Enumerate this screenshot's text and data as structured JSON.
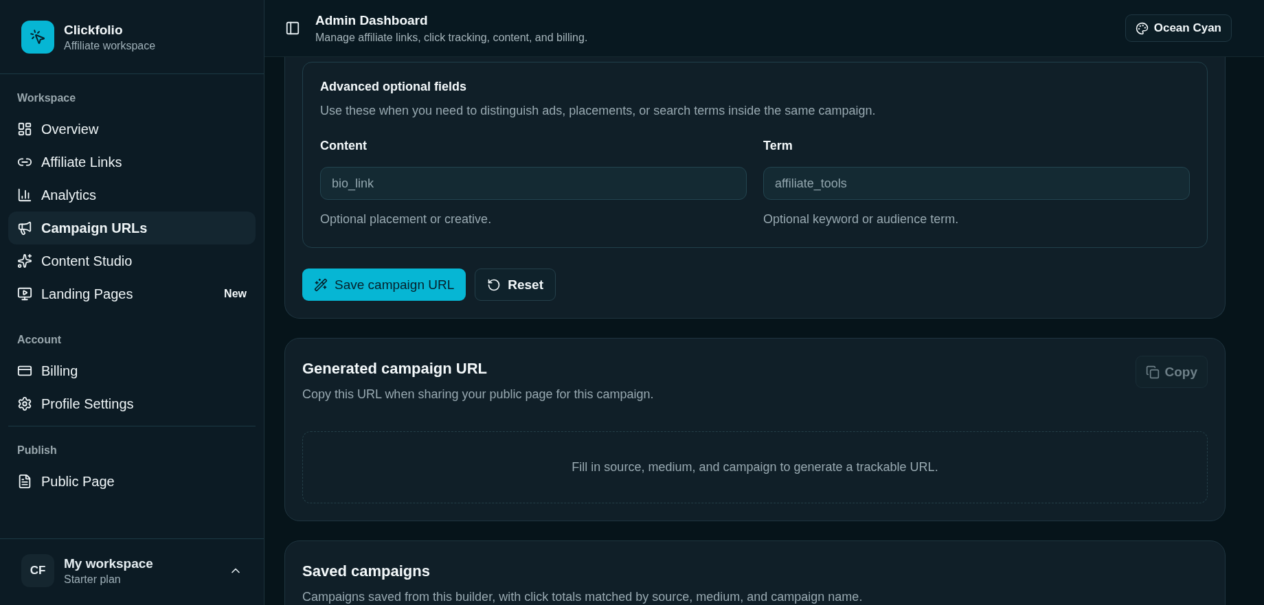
{
  "sidebar": {
    "brand": {
      "name": "Clickfolio",
      "subtitle": "Affiliate workspace"
    },
    "sections": [
      {
        "title": "Workspace",
        "items": [
          {
            "label": "Overview",
            "selected": false
          },
          {
            "label": "Affiliate Links",
            "selected": false
          },
          {
            "label": "Analytics",
            "selected": false
          },
          {
            "label": "Campaign URLs",
            "selected": true
          },
          {
            "label": "Content Studio",
            "selected": false
          },
          {
            "label": "Landing Pages",
            "selected": false,
            "badge": "New"
          }
        ]
      },
      {
        "title": "Account",
        "items": [
          {
            "label": "Billing",
            "selected": false
          },
          {
            "label": "Profile Settings",
            "selected": false
          }
        ]
      },
      {
        "title": "Publish",
        "items": [
          {
            "label": "Public Page",
            "selected": false
          }
        ]
      }
    ],
    "footer": {
      "initials": "CF",
      "name": "My workspace",
      "plan": "Starter plan"
    }
  },
  "header": {
    "title": "Admin Dashboard",
    "subtitle": "Manage affiliate links, click tracking, content, and billing.",
    "theme_button": "Ocean Cyan"
  },
  "builder": {
    "advanced": {
      "title": "Advanced optional fields",
      "description": "Use these when you need to distinguish ads, placements, or search terms inside the same campaign.",
      "fields": [
        {
          "label": "Content",
          "placeholder": "bio_link",
          "hint": "Optional placement or creative."
        },
        {
          "label": "Term",
          "placeholder": "affiliate_tools",
          "hint": "Optional keyword or audience term."
        }
      ]
    },
    "save_button": "Save campaign URL",
    "reset_button": "Reset"
  },
  "generated": {
    "title": "Generated campaign URL",
    "description": "Copy this URL when sharing your public page for this campaign.",
    "copy_button": {
      "label": "Copy",
      "disabled": true
    },
    "empty_message": "Fill in source, medium, and campaign to generate a trackable URL."
  },
  "saved": {
    "title": "Saved campaigns",
    "description": "Campaigns saved from this builder, with click totals matched by source, medium, and campaign name."
  }
}
